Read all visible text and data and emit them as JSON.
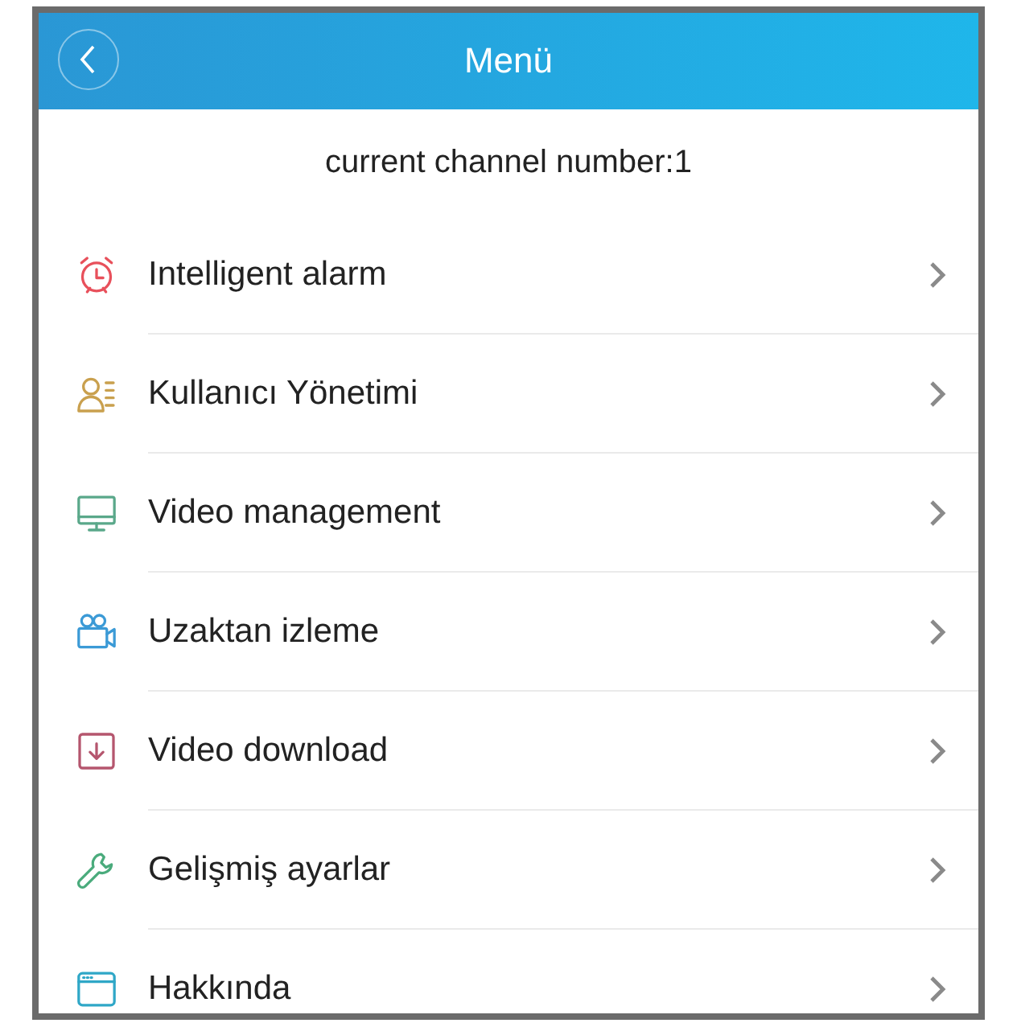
{
  "header": {
    "title": "Menü"
  },
  "channel_label": "current channel number:1",
  "items": [
    {
      "label": "Intelligent alarm"
    },
    {
      "label": "Kullanıcı Yönetimi"
    },
    {
      "label": "Video management"
    },
    {
      "label": "Uzaktan izleme"
    },
    {
      "label": "Video download"
    },
    {
      "label": "Gelişmiş ayarlar"
    },
    {
      "label": "Hakkında"
    }
  ]
}
